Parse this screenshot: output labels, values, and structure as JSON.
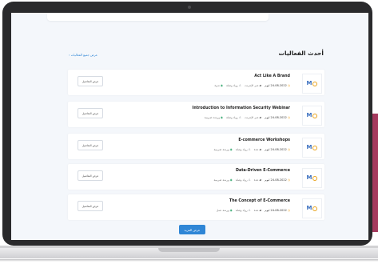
{
  "section": {
    "title": "أحدث الفعاليات",
    "view_all": "عرض جميع الفعاليات ›"
  },
  "events": [
    {
      "title": "Act Like A Brand",
      "format": "ندوة",
      "audience": "رواد وصلة",
      "location": "عبر الإنترنت",
      "date": "24-08-2022 ليوم",
      "details_label": "عرض التفاصيل"
    },
    {
      "title": "Introduction to Information Security Webinar",
      "format": "ورشة ضريبية",
      "audience": "رواد وصلة",
      "location": "عبر الإنترنت",
      "date": "24-08-2022 ليوم",
      "details_label": "عرض التفاصيل"
    },
    {
      "title": "E-commerce Workshops",
      "format": "ورشة ضريبية",
      "audience": "رواد وصلة",
      "location": "عدة",
      "date": "24-08-2022 ليوم",
      "details_label": "عرض التفاصيل"
    },
    {
      "title": "Data-Driven E-Commerce",
      "format": "ورشة ضريبية",
      "audience": "رواد وصلة",
      "location": "عدة",
      "date": "24-08-2022 ليوم",
      "details_label": "عرض التفاصيل"
    },
    {
      "title": "The Concept of E-Commerce",
      "format": "ورشة عمل",
      "audience": "رواد وصلة",
      "location": "عدة",
      "date": "24-08-2022 ليوم",
      "details_label": "عرض التفاصيل"
    }
  ],
  "more_button": "عرض المزيد",
  "icons": {
    "logo": "partner-logo-icon",
    "format": "tag-icon",
    "audience": "users-icon",
    "location": "map-pin-icon",
    "date": "clock-icon"
  },
  "colors": {
    "accent": "#2f86d6",
    "side_bar": "#a53a5e"
  }
}
